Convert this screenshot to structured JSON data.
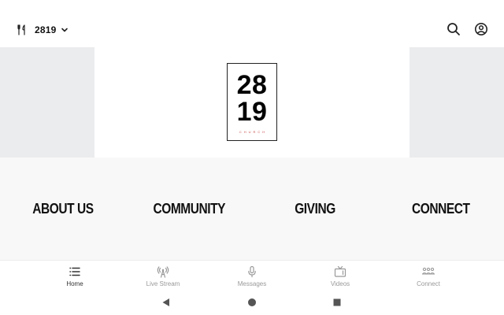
{
  "header": {
    "church_name": "2819",
    "brand_icon": "fork-knife-icon",
    "actions": [
      {
        "name": "search-button",
        "icon": "search-icon"
      },
      {
        "name": "account-button",
        "icon": "account-circle-icon"
      }
    ]
  },
  "banner": {
    "logo": {
      "line1": "28",
      "line2": "19",
      "sub": "CHURCH"
    }
  },
  "tiles": [
    {
      "label": "ABOUT US"
    },
    {
      "label": "COMMUNITY"
    },
    {
      "label": "GIVING"
    },
    {
      "label": "CONNECT"
    }
  ],
  "bottom_nav": {
    "active": "Home",
    "items": [
      {
        "label": "Home",
        "icon": "list-icon"
      },
      {
        "label": "Live Stream",
        "icon": "broadcast-icon"
      },
      {
        "label": "Messages",
        "icon": "microphone-icon"
      },
      {
        "label": "Videos",
        "icon": "tv-icon"
      },
      {
        "label": "Connect",
        "icon": "people-icon"
      }
    ]
  },
  "colors": {
    "banner_side": "#ebecee",
    "tiles_background": "#f8f8f8",
    "logo_accent": "#c94a4a",
    "nav_inactive": "#999999",
    "nav_active": "#333333"
  }
}
